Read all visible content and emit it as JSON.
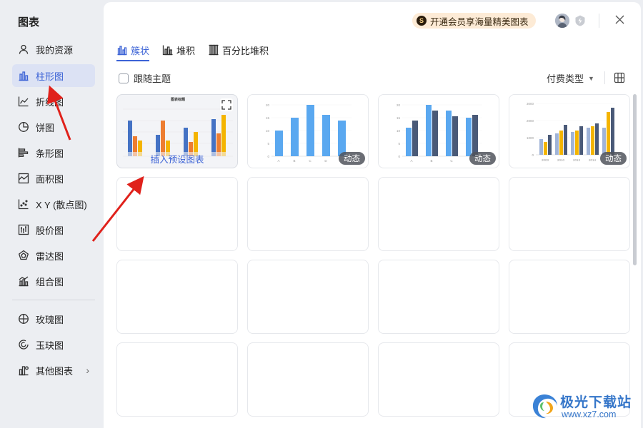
{
  "sidebar": {
    "title": "图表",
    "items": [
      {
        "label": "我的资源",
        "icon": "user-icon"
      },
      {
        "label": "柱形图",
        "icon": "bar-chart-icon",
        "active": true
      },
      {
        "label": "折线图",
        "icon": "line-chart-icon"
      },
      {
        "label": "饼图",
        "icon": "pie-chart-icon"
      },
      {
        "label": "条形图",
        "icon": "horizontal-bar-icon"
      },
      {
        "label": "面积图",
        "icon": "area-chart-icon"
      },
      {
        "label": "X Y (散点图)",
        "icon": "scatter-chart-icon"
      },
      {
        "label": "股价图",
        "icon": "stock-chart-icon"
      },
      {
        "label": "雷达图",
        "icon": "radar-chart-icon"
      },
      {
        "label": "组合图",
        "icon": "combo-chart-icon"
      },
      {
        "label": "玫瑰图",
        "icon": "rose-chart-icon"
      },
      {
        "label": "玉玦图",
        "icon": "ring-chart-icon"
      },
      {
        "label": "其他图表",
        "icon": "other-charts-icon",
        "has_submenu": true
      }
    ]
  },
  "header": {
    "vip_text": "开通会员享海量精美图表",
    "vip_icon": "vip-crown-icon"
  },
  "tabs": [
    {
      "label": "簇状",
      "icon": "clustered-bar-icon",
      "active": true
    },
    {
      "label": "堆积",
      "icon": "stacked-bar-icon"
    },
    {
      "label": "百分比堆积",
      "icon": "percent-stacked-bar-icon"
    }
  ],
  "filters": {
    "follow_theme_label": "跟随主题",
    "follow_theme_checked": false,
    "pay_type_label": "付费类型"
  },
  "cards": [
    {
      "type": "preview",
      "title": "图表标题",
      "insert_label": "插入预设图表",
      "legend": "■系列1 ■系列2 ■系列3",
      "categories": [
        "类别1",
        "类别2",
        "类别3",
        "类别4"
      ]
    },
    {
      "type": "dynamic",
      "badge": "动态",
      "y_ticks": [
        "20",
        "15",
        "10",
        "5",
        "0"
      ],
      "categories": [
        "A",
        "B",
        "C",
        "D"
      ]
    },
    {
      "type": "dynamic",
      "badge": "动态",
      "y_ticks": [
        "20",
        "15",
        "10",
        "5",
        "0"
      ],
      "categories": [
        "A",
        "B",
        "C"
      ]
    },
    {
      "type": "dynamic",
      "badge": "动态",
      "y_ticks": [
        "3000",
        "2000",
        "1000",
        "0"
      ],
      "categories": [
        "2003",
        "2010",
        "2013",
        "2014"
      ]
    }
  ],
  "colors": {
    "accent": "#3c63d6",
    "blue": "#4472c4",
    "orange": "#ed7d31",
    "gold": "#f4b400",
    "sky": "#5aa8f0",
    "slate": "#4a5a78",
    "annotation_red": "#e0211b"
  },
  "watermark": {
    "name": "极光下载站",
    "url": "www.xz7.com"
  }
}
